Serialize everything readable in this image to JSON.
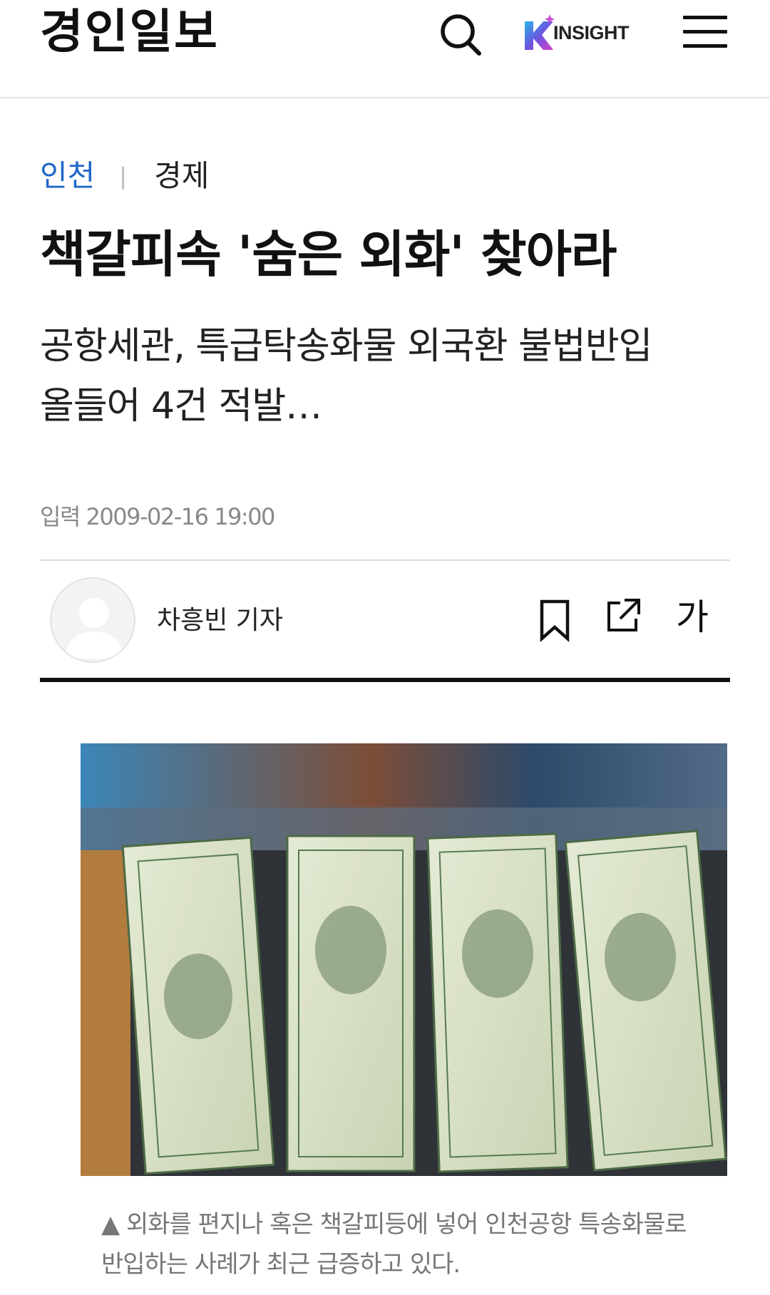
{
  "header": {
    "logo": "경인일보",
    "search_icon": "search-icon",
    "insight_label": "INSIGHT",
    "menu_icon": "hamburger-menu-icon"
  },
  "article": {
    "section": "인천",
    "separator": "|",
    "subsection": "경제",
    "headline": "책갈피속 '숨은 외화' 찾아라",
    "subtitle_line1": "공항세관, 특급탁송화물 외국환 불법반입",
    "subtitle_line2": "올들어 4건 적발…",
    "dateline": "입력 2009-02-16 19:00",
    "reporter": "차흥빈 기자",
    "font_size_label": "가",
    "caption_line1": "▲ 외화를 편지나 혹은 책갈피등에 넣어 인천공항 특송화물로",
    "caption_line2": "반입하는 사례가 최근 급증하고 있다."
  },
  "colors": {
    "section_accent": "#1f67c9",
    "text_primary": "#111111",
    "text_muted": "#888888",
    "divider": "#dcdcdc"
  },
  "icons": [
    "search-icon",
    "k-insight-logo",
    "hamburger-menu-icon",
    "avatar-placeholder-icon",
    "bookmark-icon",
    "share-icon"
  ]
}
